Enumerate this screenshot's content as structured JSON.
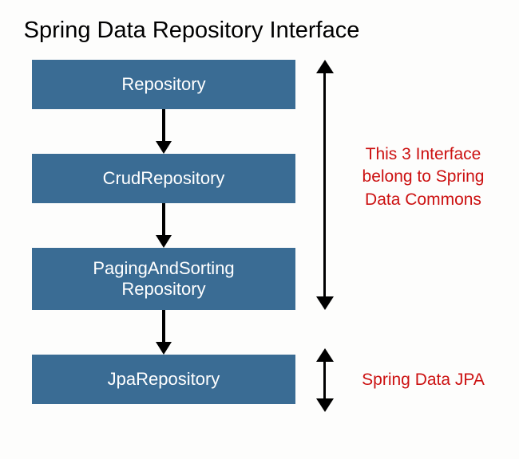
{
  "title": "Spring Data Repository Interface",
  "boxes": {
    "repository": "Repository",
    "crud": "CrudRepository",
    "paging_line1": "PagingAndSorting",
    "paging_line2": "Repository",
    "jpa": "JpaRepository"
  },
  "annotations": {
    "commons_line1": "This 3 Interface",
    "commons_line2": "belong to Spring",
    "commons_line3": "Data Commons",
    "jpa": "Spring Data JPA"
  },
  "colors": {
    "box_bg": "#3a6c94",
    "box_text": "#ffffff",
    "annotation": "#cc1111"
  }
}
